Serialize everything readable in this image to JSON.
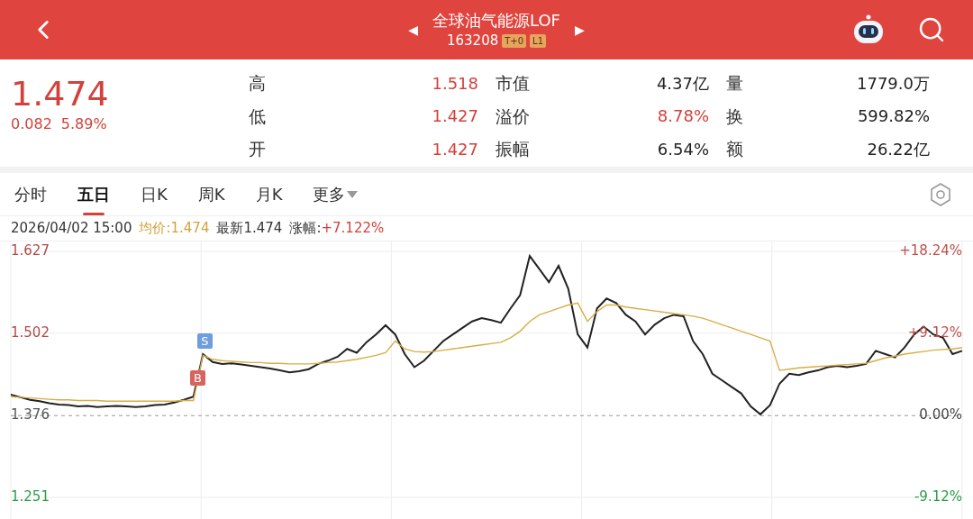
{
  "header": {
    "prev_arrow": "◀",
    "title": "全球油气能源LOF",
    "next_arrow": "▶",
    "code": "163208",
    "tags": [
      "T+0",
      "L1"
    ]
  },
  "quote": {
    "price": "1.474",
    "change": "0.082",
    "change_pct": "5.89%",
    "stats": [
      {
        "label": "高",
        "value": "1.518",
        "color": "#d2413b"
      },
      {
        "label": "市值",
        "value": "4.37亿",
        "color": "#222222"
      },
      {
        "label": "量",
        "value": "1779.0万",
        "color": "#222222"
      },
      {
        "label": "低",
        "value": "1.427",
        "color": "#d2413b"
      },
      {
        "label": "溢价",
        "value": "8.78%",
        "color": "#d2413b"
      },
      {
        "label": "换",
        "value": "599.82%",
        "color": "#222222"
      },
      {
        "label": "开",
        "value": "1.427",
        "color": "#d2413b"
      },
      {
        "label": "振幅",
        "value": "6.54%",
        "color": "#222222"
      },
      {
        "label": "额",
        "value": "26.22亿",
        "color": "#222222"
      }
    ]
  },
  "tabs": [
    {
      "label": "分时",
      "selected": false
    },
    {
      "label": "五日",
      "selected": true
    },
    {
      "label": "日K",
      "selected": false
    },
    {
      "label": "周K",
      "selected": false
    },
    {
      "label": "月K",
      "selected": false
    },
    {
      "label": "更多",
      "selected": false,
      "dropdown": true
    }
  ],
  "info": {
    "time": "2026/04/02 15:00",
    "avg": "均价:1.474",
    "latest": "最新1.474",
    "change_label": "涨幅:",
    "change_value": "+7.122%"
  },
  "chart": {
    "percent_labels": [
      {
        "text": "+18.24%",
        "color": "#c0504a"
      },
      {
        "text": "+9.12%",
        "color": "#c0504a"
      },
      {
        "text": "0.00%",
        "color": "#444444"
      },
      {
        "text": "-9.12%",
        "color": "#2e9b4b"
      }
    ],
    "signals": [
      {
        "text": "B",
        "kind": "buy"
      },
      {
        "text": "S",
        "kind": "sell"
      }
    ],
    "chart_data": {
      "type": "line",
      "ref_lines": [
        {
          "axis": "y",
          "value": 1.376
        }
      ],
      "ylim": [
        1.251,
        1.627
      ],
      "yticks": [
        1.251,
        1.376,
        1.502,
        1.627
      ],
      "series": [
        {
          "color": "#222222",
          "values": [
            1.408,
            1.404,
            1.4,
            1.398,
            1.395,
            1.393,
            1.392,
            1.39,
            1.391,
            1.389,
            1.39,
            1.391,
            1.39,
            1.389,
            1.39,
            1.392,
            1.393,
            1.396,
            1.4,
            1.405,
            1.47,
            1.458,
            1.455,
            1.456,
            1.454,
            1.452,
            1.45,
            1.448,
            1.445,
            1.442,
            1.444,
            1.447,
            1.455,
            1.46,
            1.466,
            1.478,
            1.472,
            1.488,
            1.5,
            1.514,
            1.5,
            1.47,
            1.45,
            1.46,
            1.475,
            1.49,
            1.5,
            1.51,
            1.52,
            1.525,
            1.522,
            1.518,
            1.54,
            1.56,
            1.62,
            1.6,
            1.58,
            1.605,
            1.57,
            1.5,
            1.48,
            1.54,
            1.555,
            1.548,
            1.53,
            1.52,
            1.5,
            1.515,
            1.525,
            1.53,
            1.528,
            1.49,
            1.47,
            1.44,
            1.43,
            1.42,
            1.41,
            1.39,
            1.378,
            1.392,
            1.425,
            1.44,
            1.438,
            1.442,
            1.445,
            1.45,
            1.452,
            1.45,
            1.452,
            1.455,
            1.475,
            1.47,
            1.465,
            1.48,
            1.5,
            1.512,
            1.5,
            1.495,
            1.47,
            1.475
          ]
        },
        {
          "color": "#d8ad45",
          "values": [
            1.405,
            1.404,
            1.403,
            1.402,
            1.401,
            1.4,
            1.4,
            1.399,
            1.399,
            1.399,
            1.398,
            1.398,
            1.398,
            1.398,
            1.398,
            1.398,
            1.398,
            1.398,
            1.399,
            1.399,
            1.468,
            1.462,
            1.46,
            1.459,
            1.458,
            1.457,
            1.457,
            1.456,
            1.456,
            1.455,
            1.455,
            1.455,
            1.456,
            1.457,
            1.458,
            1.46,
            1.462,
            1.465,
            1.468,
            1.472,
            1.49,
            1.478,
            1.474,
            1.473,
            1.474,
            1.476,
            1.478,
            1.48,
            1.482,
            1.484,
            1.486,
            1.488,
            1.495,
            1.505,
            1.52,
            1.53,
            1.535,
            1.54,
            1.545,
            1.548,
            1.52,
            1.535,
            1.545,
            1.545,
            1.542,
            1.54,
            1.538,
            1.536,
            1.534,
            1.532,
            1.53,
            1.528,
            1.525,
            1.52,
            1.515,
            1.51,
            1.505,
            1.5,
            1.495,
            1.49,
            1.445,
            1.447,
            1.449,
            1.45,
            1.451,
            1.452,
            1.453,
            1.454,
            1.455,
            1.456,
            1.46,
            1.464,
            1.467,
            1.47,
            1.472,
            1.474,
            1.476,
            1.477,
            1.478,
            1.48
          ]
        }
      ]
    }
  }
}
